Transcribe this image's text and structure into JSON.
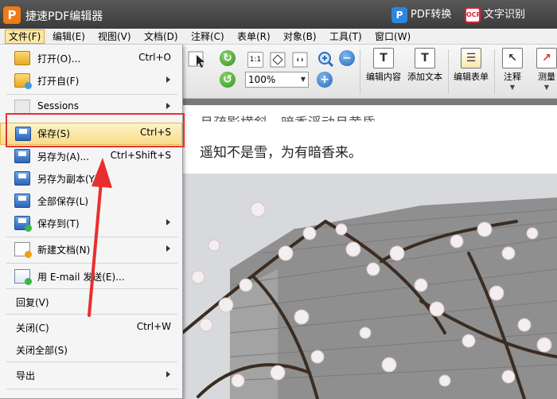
{
  "title_bar": {
    "app_title": "捷速PDF编辑器",
    "logo_letter": "P",
    "pdf_convert": "PDF转换",
    "ocr_badge": "OCR",
    "ocr_label": "文字识别"
  },
  "menu_bar": [
    {
      "label": "文件(F)"
    },
    {
      "label": "编辑(E)"
    },
    {
      "label": "视图(V)"
    },
    {
      "label": "文档(D)"
    },
    {
      "label": "注释(C)"
    },
    {
      "label": "表单(R)"
    },
    {
      "label": "对象(B)"
    },
    {
      "label": "工具(T)"
    },
    {
      "label": "窗口(W)"
    }
  ],
  "toolbar": {
    "zoom_value": "100%",
    "page_fit_label": "1:1",
    "edit_content": "编辑内容",
    "add_text": "添加文本",
    "edit_form": "编辑表单",
    "annotate": "注释",
    "measure": "测量"
  },
  "document": {
    "line1": "月疏影横斜，暗香浮动月黄昏。",
    "line2": "遥知不是雪，为有暗香来。"
  },
  "file_menu": {
    "items": [
      {
        "label": "打开(O)...",
        "shortcut": "Ctrl+O"
      },
      {
        "label": "打开自(F)",
        "shortcut": ""
      },
      {
        "label": "Sessions",
        "shortcut": ""
      },
      {
        "label": "保存(S)",
        "shortcut": "Ctrl+S"
      },
      {
        "label": "另存为(A)...",
        "shortcut": "Ctrl+Shift+S"
      },
      {
        "label": "另存为副本(Y)...",
        "shortcut": ""
      },
      {
        "label": "全部保存(L)",
        "shortcut": ""
      },
      {
        "label": "保存到(T)",
        "shortcut": ""
      },
      {
        "label": "新建文档(N)",
        "shortcut": ""
      },
      {
        "label": "用 E-mail 发送(E)...",
        "shortcut": ""
      },
      {
        "label": "回复(V)",
        "shortcut": ""
      },
      {
        "label": "关闭(C)",
        "shortcut": "Ctrl+W"
      },
      {
        "label": "关闭全部(S)",
        "shortcut": ""
      },
      {
        "label": "导出",
        "shortcut": ""
      }
    ]
  },
  "colors": {
    "highlight": "#f8dc88",
    "annotation_red": "#e82f2f",
    "logo_orange": "#f07a14"
  }
}
